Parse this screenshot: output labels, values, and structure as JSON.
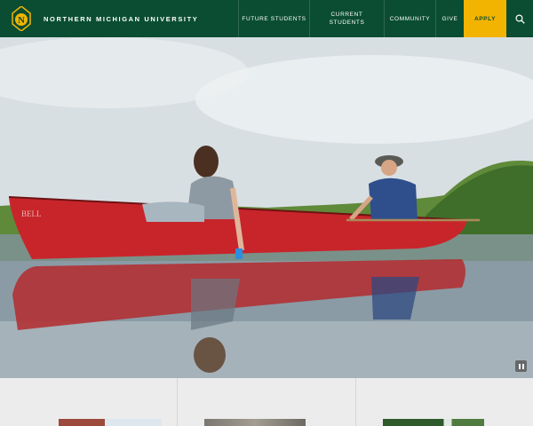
{
  "header": {
    "brand_name": "NORTHERN MICHIGAN UNIVERSITY",
    "logo_icon": "nmu-n-logo-icon",
    "nav": {
      "future_students": "FUTURE STUDENTS",
      "current_students_line1": "CURRENT",
      "current_students_line2": "STUDENTS",
      "community": "COMMUNITY",
      "give": "GIVE",
      "apply": "APPLY"
    },
    "search_icon": "search-icon"
  },
  "hero": {
    "canoe_text": "BELL",
    "pause_icon": "pause-icon"
  },
  "colors": {
    "brand_green": "#0a4d32",
    "apply_gold": "#f2b400",
    "canoe_red": "#c8252b"
  }
}
